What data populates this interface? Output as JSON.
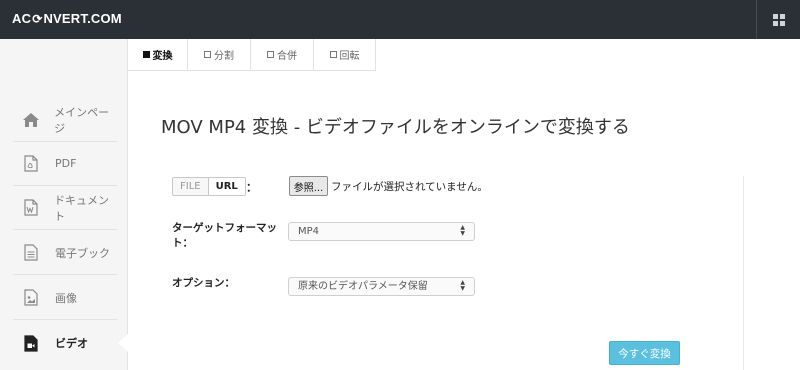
{
  "header": {
    "logo_prefix": "AC",
    "logo_suffix": "NVERT.COM",
    "logo_mark_icon": "refresh-icon",
    "menu_icon": "grid-icon"
  },
  "sidebar": {
    "items": [
      {
        "label": "メインページ",
        "icon": "home-icon",
        "active": false
      },
      {
        "label": "PDF",
        "icon": "pdf-icon",
        "active": false
      },
      {
        "label": "ドキュメント",
        "icon": "word-doc-icon",
        "active": false
      },
      {
        "label": "電子ブック",
        "icon": "ebook-icon",
        "active": false
      },
      {
        "label": "画像",
        "icon": "image-icon",
        "active": false
      },
      {
        "label": "ビデオ",
        "icon": "video-icon",
        "active": true
      }
    ]
  },
  "tabs": [
    {
      "label": "変換",
      "active": true
    },
    {
      "label": "分割",
      "active": false
    },
    {
      "label": "合併",
      "active": false
    },
    {
      "label": "回転",
      "active": false
    }
  ],
  "main": {
    "title": "MOV MP4 変換 - ビデオファイルをオンラインで変換する",
    "source": {
      "file_label": "FILE",
      "url_label": "URL",
      "selected": "URL",
      "colon": "：",
      "browse_label": "参照...",
      "file_status": "ファイルが選択されていません。"
    },
    "format": {
      "label": "ターゲットフォーマット：",
      "value": "MP4"
    },
    "options": {
      "label": "オプション：",
      "value": "原来のビデオパラメータ保留"
    },
    "convert_label": "今すぐ変換"
  },
  "colors": {
    "topbar": "#2a3036",
    "sidebar": "#f5f5f5",
    "accent": "#5bc0de"
  }
}
